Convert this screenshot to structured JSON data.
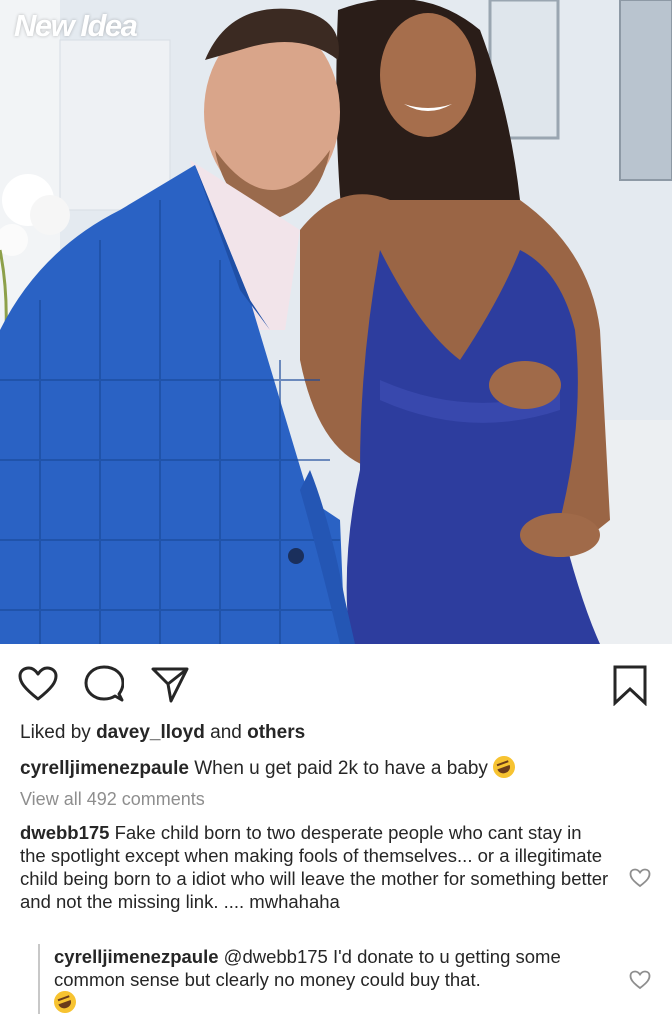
{
  "photo": {
    "watermark": "New Idea",
    "colors": {
      "suit": "#2a62c4",
      "dress": "#2d3d9e",
      "background": "#e2e8ef"
    }
  },
  "actions": {
    "like_icon": "heart-outline-icon",
    "comment_icon": "comment-bubble-icon",
    "share_icon": "paper-plane-icon",
    "save_icon": "bookmark-icon"
  },
  "likes": {
    "prefix": "Liked by",
    "user": "davey_lloyd",
    "joiner": "and",
    "others": "others"
  },
  "caption": {
    "username": "cyrelljimenezpaule",
    "text": "When u get paid 2k to have a baby",
    "emoji": "rolling-on-floor-laughing"
  },
  "view_all": "View all 492 comments",
  "comments": [
    {
      "username": "dwebb175",
      "text": "Fake child born to two desperate people who cant stay in the spotlight except when making fools of themselves... or a illegitimate child being born to a idiot who will leave the mother for something better and not the missing link. .... mwhahaha"
    }
  ],
  "reply": {
    "username": "cyrelljimenezpaule",
    "mention": "@dwebb175",
    "text": "I'd donate to u getting some common sense but clearly no money could buy that.",
    "emoji": "rolling-on-floor-laughing"
  }
}
